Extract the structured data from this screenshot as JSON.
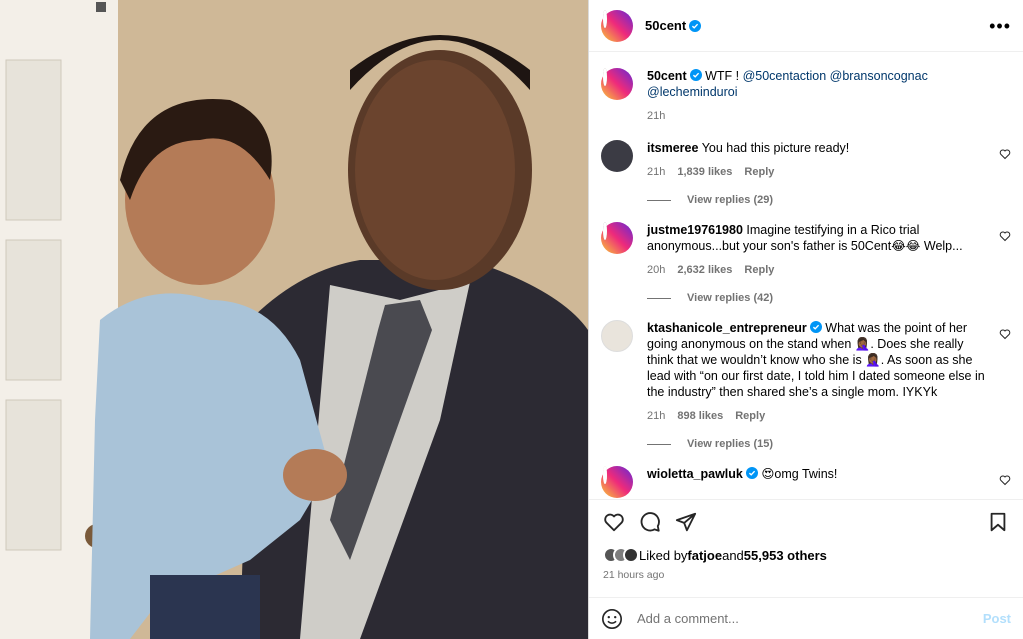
{
  "header": {
    "username": "50cent",
    "more_icon": "more-horizontal-icon"
  },
  "caption": {
    "username": "50cent",
    "text_prefix": "WTF ! ",
    "mentions": [
      "@50centaction",
      "@bransoncognac",
      "@lecheminduroi"
    ],
    "time": "21h"
  },
  "comments": [
    {
      "username": "itsmeree",
      "verified": false,
      "text": "You had this picture ready!",
      "time": "21h",
      "likes": "1,839 likes",
      "reply": "Reply",
      "view_replies": "View replies (29)"
    },
    {
      "username": "justme19761980",
      "verified": false,
      "text": "Imagine testifying in a Rico trial anonymous...but your son's father is 50Cent😂😂 Welp...",
      "time": "20h",
      "likes": "2,632 likes",
      "reply": "Reply",
      "view_replies": "View replies (42)"
    },
    {
      "username": "ktashanicole_entrepreneur",
      "verified": true,
      "text": "What was the point of her going anonymous on the stand when 🤦🏾‍♀️. Does she really think that we wouldn’t know who she is 🤦🏾‍♀️. As soon as she lead with “on our first date, I told him I dated someone else in the industry” then shared she’s a single mom. IYKYk",
      "time": "21h",
      "likes": "898 likes",
      "reply": "Reply",
      "view_replies": "View replies (15)"
    },
    {
      "username": "wioletta_pawluk",
      "verified": true,
      "text": "😍omg Twins!"
    }
  ],
  "actions": {
    "like_icon": "heart-icon",
    "comment_icon": "comment-icon",
    "share_icon": "send-icon",
    "save_icon": "bookmark-icon"
  },
  "likes": {
    "prefix": "Liked by ",
    "user": "fatjoe",
    "middle": " and ",
    "count": "55,953 others"
  },
  "posted_ago": "21 hours ago",
  "add_comment": {
    "placeholder": "Add a comment...",
    "post_label": "Post",
    "emoji_icon": "emoji-icon"
  },
  "colors": {
    "verified": "#0095f6",
    "link": "#00376b",
    "muted": "#737373",
    "post_disabled": "#b2dffc"
  }
}
